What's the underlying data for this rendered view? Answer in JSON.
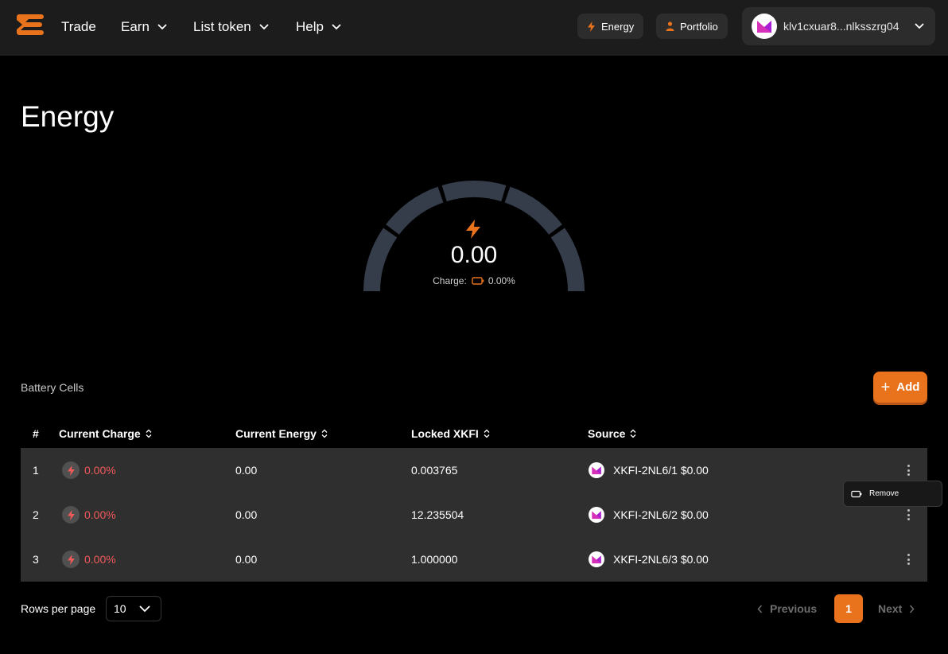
{
  "colors": {
    "accent": "#e8731c",
    "header_bg": "#1c1c1c",
    "row_bg": "#2f2f2f",
    "danger": "#f05a5a"
  },
  "nav": {
    "logo": "logo-icon",
    "items": [
      {
        "label": "Trade",
        "has_dropdown": false
      },
      {
        "label": "Earn",
        "has_dropdown": true
      },
      {
        "label": "List token",
        "has_dropdown": true
      },
      {
        "label": "Help",
        "has_dropdown": true
      }
    ],
    "energy_button": "Energy",
    "portfolio_button": "Portfolio",
    "wallet_address": "klv1cxuar8...nlksszrg04"
  },
  "page": {
    "title": "Energy"
  },
  "gauge": {
    "value": "0.00",
    "charge_label": "Charge:",
    "charge_value": "0.00%",
    "fill_fraction": 0
  },
  "battery_cells": {
    "label": "Battery Cells",
    "add_button": "Add",
    "columns": [
      "#",
      "Current Charge",
      "Current Energy",
      "Locked XKFI",
      "Source"
    ],
    "rows": [
      {
        "index": "1",
        "charge": "0.00%",
        "energy": "0.00",
        "locked": "0.003765",
        "source": "XKFI-2NL6/1 $0.00"
      },
      {
        "index": "2",
        "charge": "0.00%",
        "energy": "0.00",
        "locked": "12.235504",
        "source": "XKFI-2NL6/2 $0.00"
      },
      {
        "index": "3",
        "charge": "0.00%",
        "energy": "0.00",
        "locked": "1.000000",
        "source": "XKFI-2NL6/3 $0.00"
      }
    ],
    "row_menu": {
      "remove_label": "Remove"
    }
  },
  "pagination": {
    "rows_per_page_label": "Rows per page",
    "rows_per_page_value": "10",
    "previous_label": "Previous",
    "current_page": "1",
    "next_label": "Next"
  }
}
